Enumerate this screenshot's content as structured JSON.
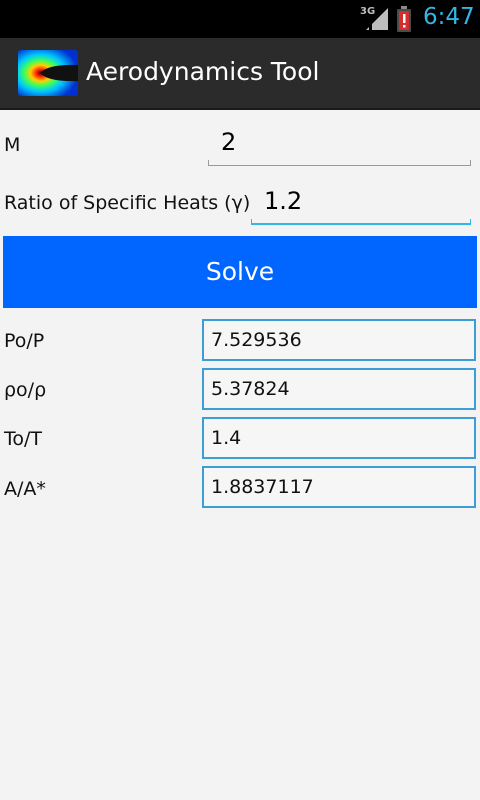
{
  "status_bar": {
    "network": "3G",
    "time": "6:47",
    "icons": [
      "signal-icon",
      "battery-alert-icon"
    ],
    "colors": {
      "time": "#33b5e5",
      "battery_alert": "#d32f2f"
    }
  },
  "action_bar": {
    "title": "Aerodynamics Tool",
    "icon": "aerodynamics-contour-icon"
  },
  "inputs": {
    "mach": {
      "label": "M",
      "value": "2"
    },
    "gamma": {
      "label": "Ratio of Specific Heats (γ)",
      "value": "1.2"
    }
  },
  "solve": {
    "label": "Solve",
    "color": "#0066ff"
  },
  "results": [
    {
      "label": "Po/P",
      "value": "7.529536"
    },
    {
      "label": "ρo/ρ",
      "value": "5.37824"
    },
    {
      "label": "To/T",
      "value": "1.4"
    },
    {
      "label": "A/A*",
      "value": "1.8837117"
    }
  ]
}
